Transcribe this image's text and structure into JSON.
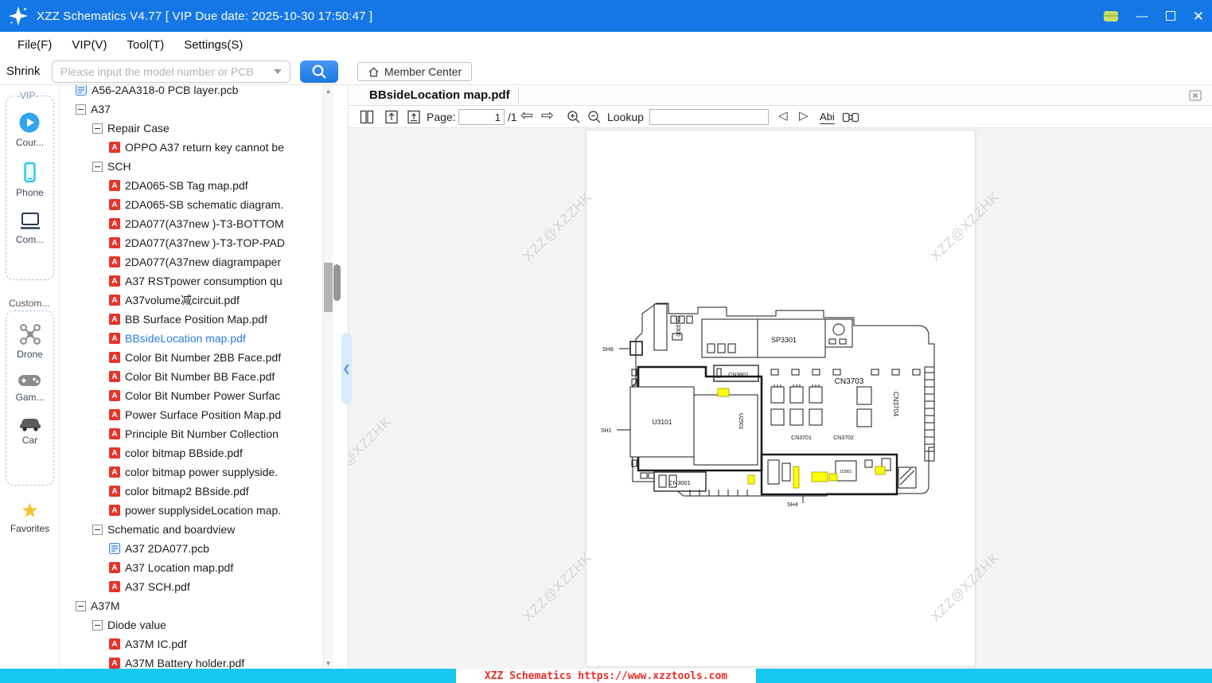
{
  "window": {
    "title": "XZZ Schematics V4.77 [ VIP Due date: 2025-10-30 17:50:47 ]"
  },
  "menu": {
    "items": [
      {
        "label": "File(F)"
      },
      {
        "label": "VIP(V)"
      },
      {
        "label": "Tool(T)"
      },
      {
        "label": "Settings(S)"
      }
    ]
  },
  "toolbar": {
    "shrink_label": "Shrink",
    "search_placeholder": "Please input the model number or PCB",
    "member_center_label": "Member Center"
  },
  "sidebar": {
    "vip_group_label": "-VIP-",
    "vip_items": [
      {
        "label": "Cour..."
      },
      {
        "label": "Phone"
      },
      {
        "label": "Com..."
      }
    ],
    "custom_group_label": "Custom...",
    "custom_items": [
      {
        "label": "Drone"
      },
      {
        "label": "Gam..."
      },
      {
        "label": "Car"
      }
    ],
    "favorites_label": "Favorites"
  },
  "tree": {
    "items": [
      {
        "label": "A56-2AA318-0 PCB layer.pcb",
        "type": "pcb",
        "level": 0
      },
      {
        "label": "A37",
        "type": "folder",
        "level": 0
      },
      {
        "label": "Repair Case",
        "type": "folder",
        "level": 1
      },
      {
        "label": "OPPO A37 return key cannot be",
        "type": "pdf",
        "level": 2
      },
      {
        "label": "SCH",
        "type": "folder",
        "level": 1
      },
      {
        "label": "2DA065-SB Tag map.pdf",
        "type": "pdf",
        "level": 2
      },
      {
        "label": "2DA065-SB schematic diagram.",
        "type": "pdf",
        "level": 2
      },
      {
        "label": "2DA077(A37new )-T3-BOTTOM",
        "type": "pdf",
        "level": 2
      },
      {
        "label": "2DA077(A37new )-T3-TOP-PAD",
        "type": "pdf",
        "level": 2
      },
      {
        "label": "2DA077(A37new diagrampaper",
        "type": "pdf",
        "level": 2
      },
      {
        "label": "A37 RSTpower consumption qu",
        "type": "pdf",
        "level": 2
      },
      {
        "label": "A37volume减circuit.pdf",
        "type": "pdf",
        "level": 2
      },
      {
        "label": "BB Surface Position Map.pdf",
        "type": "pdf",
        "level": 2
      },
      {
        "label": "BBsideLocation map.pdf",
        "type": "pdf",
        "level": 2,
        "selected": true
      },
      {
        "label": "Color Bit Number 2BB Face.pdf",
        "type": "pdf",
        "level": 2
      },
      {
        "label": "Color Bit Number BB Face.pdf",
        "type": "pdf",
        "level": 2
      },
      {
        "label": "Color Bit Number Power Surfac",
        "type": "pdf",
        "level": 2
      },
      {
        "label": "Power Surface Position Map.pd",
        "type": "pdf",
        "level": 2
      },
      {
        "label": "Principle Bit Number Collection",
        "type": "pdf",
        "level": 2
      },
      {
        "label": "color bitmap BBside.pdf",
        "type": "pdf",
        "level": 2
      },
      {
        "label": "color bitmap power supplyside.",
        "type": "pdf",
        "level": 2
      },
      {
        "label": "color bitmap2 BBside.pdf",
        "type": "pdf",
        "level": 2
      },
      {
        "label": "power supplysideLocation map.",
        "type": "pdf",
        "level": 2
      },
      {
        "label": "Schematic and boardview",
        "type": "folder",
        "level": 1
      },
      {
        "label": "A37 2DA077.pcb",
        "type": "pcb",
        "level": 2
      },
      {
        "label": "A37 Location map.pdf",
        "type": "pdf",
        "level": 2
      },
      {
        "label": "A37 SCH.pdf",
        "type": "pdf",
        "level": 2
      },
      {
        "label": "A37M",
        "type": "folder",
        "level": 0
      },
      {
        "label": "Diode value",
        "type": "folder",
        "level": 1
      },
      {
        "label": "A37M IC.pdf",
        "type": "pdf",
        "level": 2
      },
      {
        "label": "A37M Battery holder.pdf",
        "type": "pdf",
        "level": 2
      }
    ]
  },
  "viewer": {
    "tab_title": "BBsideLocation map.pdf",
    "page_label": "Page:",
    "page_value": "1",
    "page_total": "/1",
    "lookup_label": "Lookup",
    "lookup_value": "",
    "abi_label": "Abi",
    "watermark": "XZZ@XZZHK"
  },
  "schematic": {
    "labels": {
      "cn3300": "CN3300",
      "sp3301": "SP3301",
      "sh8": "SH8",
      "cn3801": "CN3801",
      "cn3703": "CN3703",
      "cn3704": "CN3704",
      "u3101": "U3101",
      "u2501": "U2501",
      "cn3701": "CN3701",
      "cn3702": "CN3702",
      "sh1": "SH1",
      "cn3001": "CN3001",
      "u3901": "U3901",
      "sh4": "SH4"
    }
  },
  "status_bar": {
    "text": "XZZ Schematics https://www.xzztools.com"
  },
  "colors": {
    "titlebar": "#1577e6",
    "accent": "#2a7de1",
    "status_cyan": "#18c8f0",
    "status_text": "#e8302a",
    "pdf_red": "#e5352b",
    "pcb_blue": "#3b82e8",
    "highlight": "#ffff00"
  }
}
